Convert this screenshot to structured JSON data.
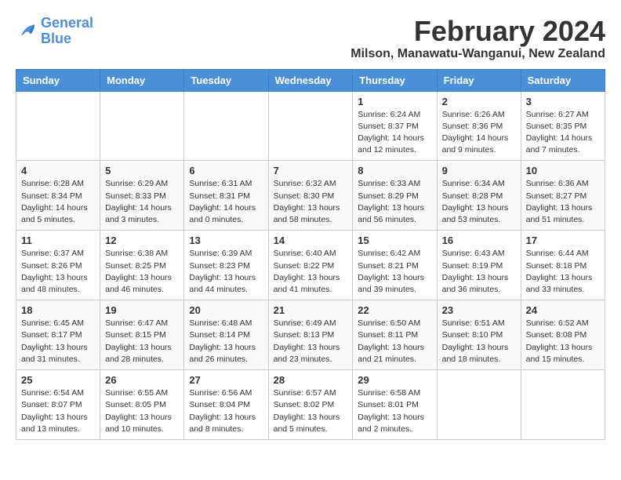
{
  "logo": {
    "line1": "General",
    "line2": "Blue"
  },
  "title": "February 2024",
  "subtitle": "Milson, Manawatu-Wanganui, New Zealand",
  "days_of_week": [
    "Sunday",
    "Monday",
    "Tuesday",
    "Wednesday",
    "Thursday",
    "Friday",
    "Saturday"
  ],
  "weeks": [
    [
      {
        "day": "",
        "info": ""
      },
      {
        "day": "",
        "info": ""
      },
      {
        "day": "",
        "info": ""
      },
      {
        "day": "",
        "info": ""
      },
      {
        "day": "1",
        "info": "Sunrise: 6:24 AM\nSunset: 8:37 PM\nDaylight: 14 hours\nand 12 minutes."
      },
      {
        "day": "2",
        "info": "Sunrise: 6:26 AM\nSunset: 8:36 PM\nDaylight: 14 hours\nand 9 minutes."
      },
      {
        "day": "3",
        "info": "Sunrise: 6:27 AM\nSunset: 8:35 PM\nDaylight: 14 hours\nand 7 minutes."
      }
    ],
    [
      {
        "day": "4",
        "info": "Sunrise: 6:28 AM\nSunset: 8:34 PM\nDaylight: 14 hours\nand 5 minutes."
      },
      {
        "day": "5",
        "info": "Sunrise: 6:29 AM\nSunset: 8:33 PM\nDaylight: 14 hours\nand 3 minutes."
      },
      {
        "day": "6",
        "info": "Sunrise: 6:31 AM\nSunset: 8:31 PM\nDaylight: 14 hours\nand 0 minutes."
      },
      {
        "day": "7",
        "info": "Sunrise: 6:32 AM\nSunset: 8:30 PM\nDaylight: 13 hours\nand 58 minutes."
      },
      {
        "day": "8",
        "info": "Sunrise: 6:33 AM\nSunset: 8:29 PM\nDaylight: 13 hours\nand 56 minutes."
      },
      {
        "day": "9",
        "info": "Sunrise: 6:34 AM\nSunset: 8:28 PM\nDaylight: 13 hours\nand 53 minutes."
      },
      {
        "day": "10",
        "info": "Sunrise: 6:36 AM\nSunset: 8:27 PM\nDaylight: 13 hours\nand 51 minutes."
      }
    ],
    [
      {
        "day": "11",
        "info": "Sunrise: 6:37 AM\nSunset: 8:26 PM\nDaylight: 13 hours\nand 48 minutes."
      },
      {
        "day": "12",
        "info": "Sunrise: 6:38 AM\nSunset: 8:25 PM\nDaylight: 13 hours\nand 46 minutes."
      },
      {
        "day": "13",
        "info": "Sunrise: 6:39 AM\nSunset: 8:23 PM\nDaylight: 13 hours\nand 44 minutes."
      },
      {
        "day": "14",
        "info": "Sunrise: 6:40 AM\nSunset: 8:22 PM\nDaylight: 13 hours\nand 41 minutes."
      },
      {
        "day": "15",
        "info": "Sunrise: 6:42 AM\nSunset: 8:21 PM\nDaylight: 13 hours\nand 39 minutes."
      },
      {
        "day": "16",
        "info": "Sunrise: 6:43 AM\nSunset: 8:19 PM\nDaylight: 13 hours\nand 36 minutes."
      },
      {
        "day": "17",
        "info": "Sunrise: 6:44 AM\nSunset: 8:18 PM\nDaylight: 13 hours\nand 33 minutes."
      }
    ],
    [
      {
        "day": "18",
        "info": "Sunrise: 6:45 AM\nSunset: 8:17 PM\nDaylight: 13 hours\nand 31 minutes."
      },
      {
        "day": "19",
        "info": "Sunrise: 6:47 AM\nSunset: 8:15 PM\nDaylight: 13 hours\nand 28 minutes."
      },
      {
        "day": "20",
        "info": "Sunrise: 6:48 AM\nSunset: 8:14 PM\nDaylight: 13 hours\nand 26 minutes."
      },
      {
        "day": "21",
        "info": "Sunrise: 6:49 AM\nSunset: 8:13 PM\nDaylight: 13 hours\nand 23 minutes."
      },
      {
        "day": "22",
        "info": "Sunrise: 6:50 AM\nSunset: 8:11 PM\nDaylight: 13 hours\nand 21 minutes."
      },
      {
        "day": "23",
        "info": "Sunrise: 6:51 AM\nSunset: 8:10 PM\nDaylight: 13 hours\nand 18 minutes."
      },
      {
        "day": "24",
        "info": "Sunrise: 6:52 AM\nSunset: 8:08 PM\nDaylight: 13 hours\nand 15 minutes."
      }
    ],
    [
      {
        "day": "25",
        "info": "Sunrise: 6:54 AM\nSunset: 8:07 PM\nDaylight: 13 hours\nand 13 minutes."
      },
      {
        "day": "26",
        "info": "Sunrise: 6:55 AM\nSunset: 8:05 PM\nDaylight: 13 hours\nand 10 minutes."
      },
      {
        "day": "27",
        "info": "Sunrise: 6:56 AM\nSunset: 8:04 PM\nDaylight: 13 hours\nand 8 minutes."
      },
      {
        "day": "28",
        "info": "Sunrise: 6:57 AM\nSunset: 8:02 PM\nDaylight: 13 hours\nand 5 minutes."
      },
      {
        "day": "29",
        "info": "Sunrise: 6:58 AM\nSunset: 8:01 PM\nDaylight: 13 hours\nand 2 minutes."
      },
      {
        "day": "",
        "info": ""
      },
      {
        "day": "",
        "info": ""
      }
    ]
  ]
}
